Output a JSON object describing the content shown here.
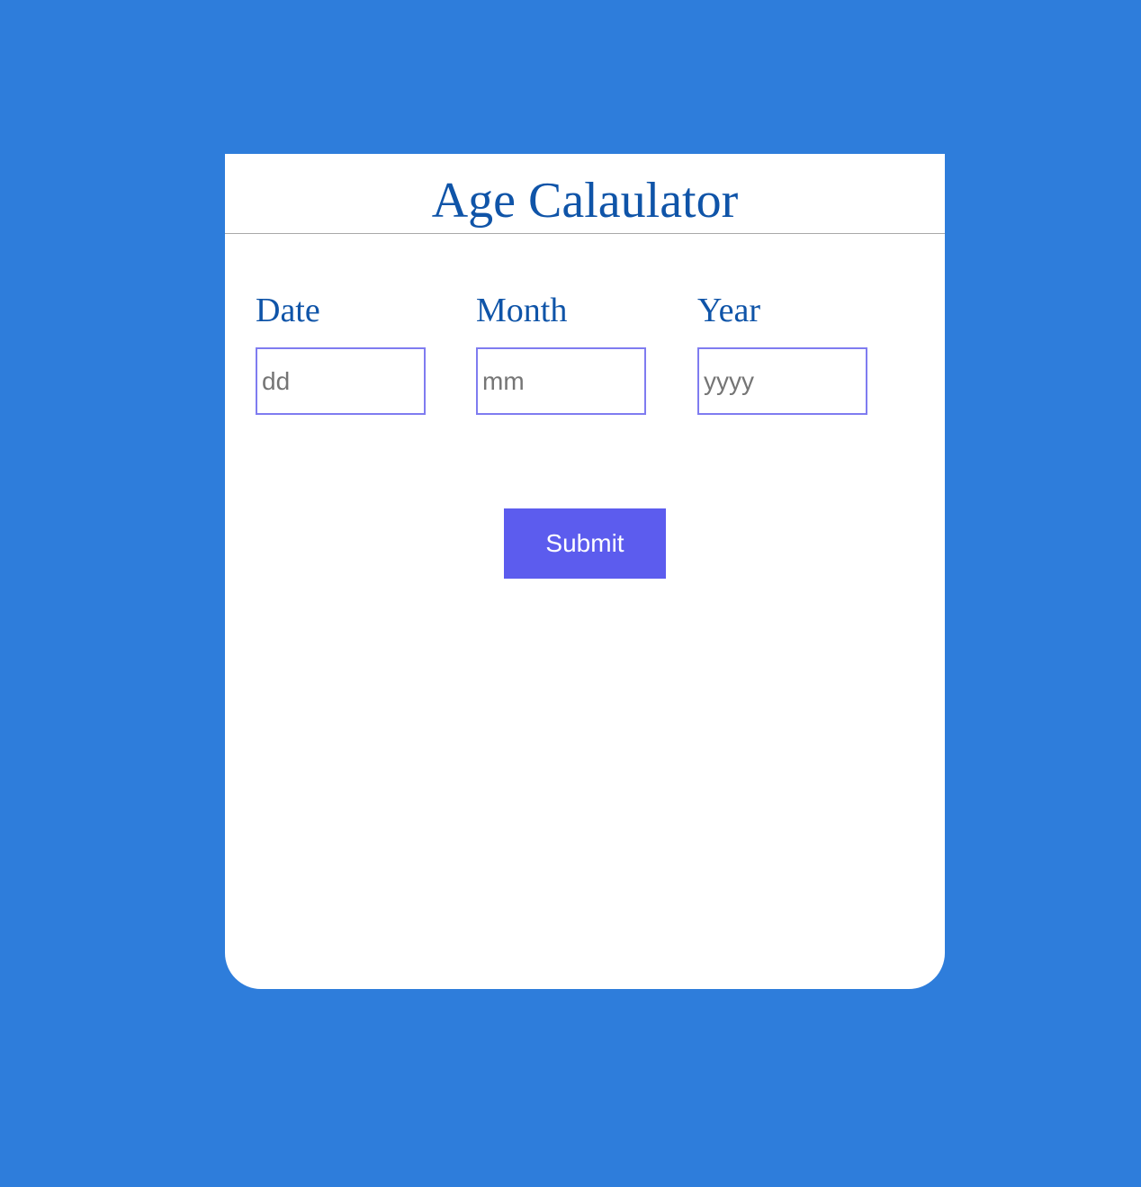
{
  "app": {
    "title": "Age Calaulator"
  },
  "form": {
    "fields": [
      {
        "label": "Date",
        "placeholder": "dd",
        "value": ""
      },
      {
        "label": "Month",
        "placeholder": "mm",
        "value": ""
      },
      {
        "label": "Year",
        "placeholder": "yyyy",
        "value": ""
      }
    ],
    "submit_label": "Submit"
  },
  "colors": {
    "page_background": "#2e7ddb",
    "card_background": "#ffffff",
    "heading_text": "#0f54a8",
    "input_border": "#7f7cf0",
    "button_background": "#5c5cee",
    "button_text": "#ffffff"
  }
}
